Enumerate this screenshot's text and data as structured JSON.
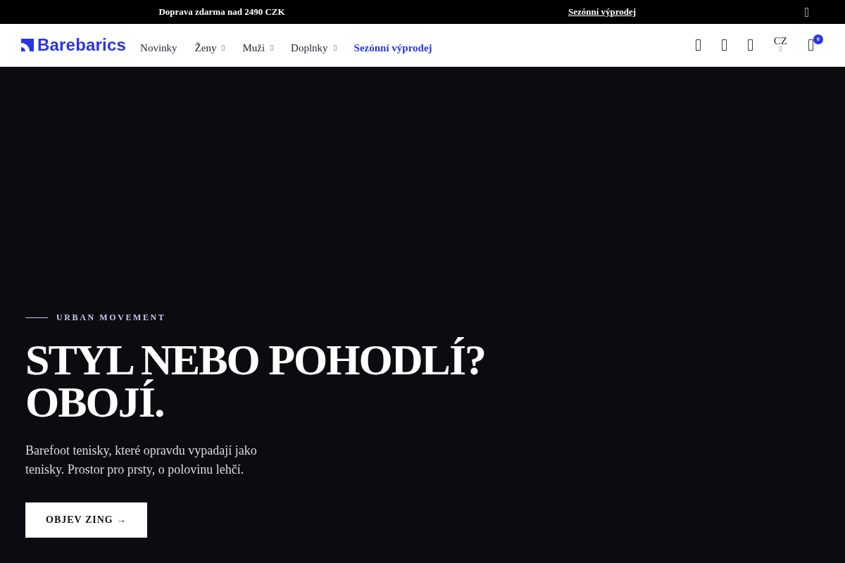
{
  "announcement_bar": {
    "items": [
      {
        "kind": "text",
        "label": "Doprava zdarma nad 2490 CZK"
      },
      {
        "kind": "link",
        "label": "Sezónní výprodej"
      }
    ]
  },
  "header": {
    "logo": "Barebarics",
    "nav": [
      {
        "label": "Novinky",
        "kind": "link",
        "has_dropdown": false
      },
      {
        "label": "Ženy",
        "kind": "link",
        "has_dropdown": true
      },
      {
        "label": "Muži",
        "kind": "link",
        "has_dropdown": true
      },
      {
        "label": "Doplnky",
        "kind": "link",
        "has_dropdown": true
      },
      {
        "label": "Sezónní výprodej",
        "kind": "promo",
        "has_dropdown": false
      }
    ],
    "language": "CZ",
    "cart_count": "0"
  },
  "hero": {
    "eyebrow": "URBAN MOVEMENT",
    "headline": "STYL NEBO POHODLÍ? OBOJÍ.",
    "text": "Barefoot tenisky, které opravdu vypadají jako tenisky. Prostor pro prsty, o polovinu lehčí.",
    "button": "OBJEV ZING →"
  }
}
